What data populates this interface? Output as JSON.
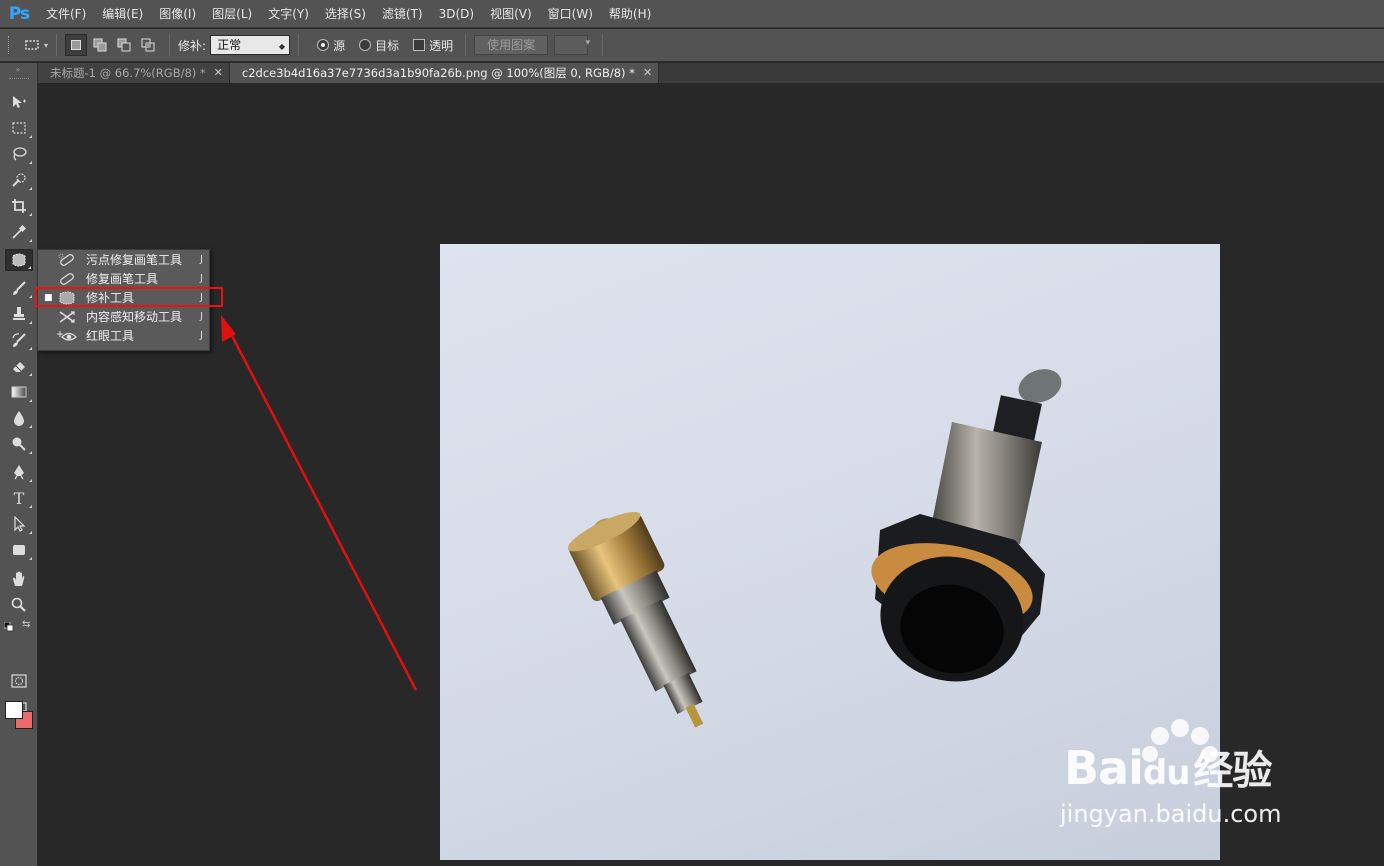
{
  "app": {
    "logo": "Ps",
    "menu": [
      "文件(F)",
      "编辑(E)",
      "图像(I)",
      "图层(L)",
      "文字(Y)",
      "选择(S)",
      "滤镜(T)",
      "3D(D)",
      "视图(V)",
      "窗口(W)",
      "帮助(H)"
    ]
  },
  "options": {
    "patch_label": "修补:",
    "patch_mode": "正常",
    "source_label": "源",
    "destination_label": "目标",
    "transparent_label": "透明",
    "use_pattern_label": "使用图案",
    "source_checked": true
  },
  "tabs": [
    {
      "label": "未标题-1 @ 66.7%(RGB/8) *",
      "active": false
    },
    {
      "label": "c2dce3b4d16a37e7736d3a1b90fa26b.png @ 100%(图层 0, RGB/8) *",
      "active": true
    }
  ],
  "flyout": {
    "items": [
      {
        "label": "污点修复画笔工具",
        "key": "J",
        "icon": "spot-healing-brush-icon",
        "selected": false
      },
      {
        "label": "修复画笔工具",
        "key": "J",
        "icon": "healing-brush-icon",
        "selected": false
      },
      {
        "label": "修补工具",
        "key": "J",
        "icon": "patch-icon",
        "selected": true
      },
      {
        "label": "内容感知移动工具",
        "key": "J",
        "icon": "content-aware-move-icon",
        "selected": false
      },
      {
        "label": "红眼工具",
        "key": "J",
        "icon": "red-eye-icon",
        "selected": false
      }
    ]
  },
  "colors": {
    "foreground": "#ffffff",
    "background": "#e86a6a",
    "highlight": "#ee1111",
    "accent": "#31a8ff"
  },
  "watermark": {
    "brand_left": "Bai",
    "brand_right": "du",
    "brand_cn": "经验",
    "url": "jingyan.baidu.com"
  }
}
